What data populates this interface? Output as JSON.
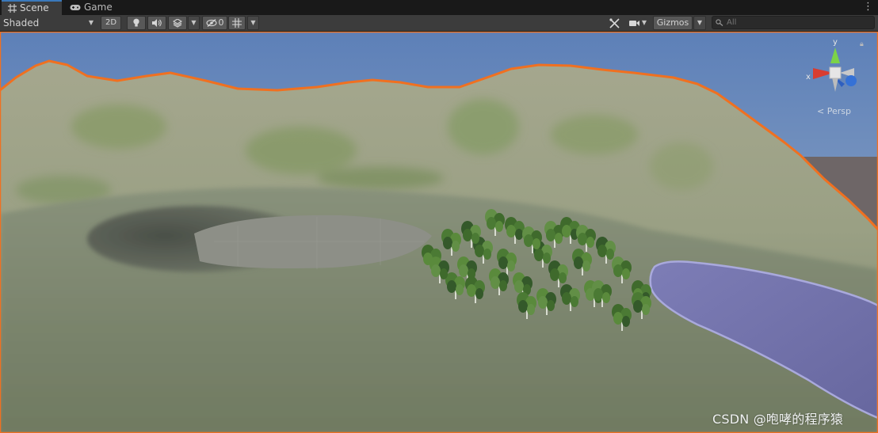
{
  "tabs": {
    "scene_label": "Scene",
    "game_label": "Game"
  },
  "toolbar": {
    "draw_mode": "Shaded",
    "two_d_label": "2D",
    "hidden_count": "0",
    "gizmos_label": "Gizmos",
    "search_placeholder": "All"
  },
  "viewport": {
    "axis_x": "x",
    "axis_y": "y",
    "perspective_label": "< Persp"
  },
  "watermark": "CSDN @咆哮的程序猿",
  "colors": {
    "selection_outline": "#f07020",
    "water": "#7a7ab4",
    "sky": "#6d8fc2",
    "terrain": "#8e9a78"
  }
}
